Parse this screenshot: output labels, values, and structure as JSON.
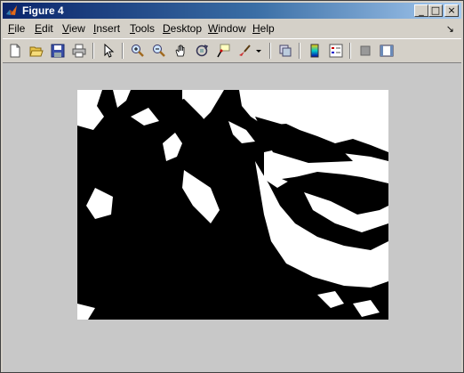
{
  "window": {
    "title": "Figure 4"
  },
  "title_buttons": {
    "minimize": "_",
    "maximize": "□",
    "close": "×"
  },
  "menu": [
    {
      "label": "File",
      "u": "F",
      "rest": "ile"
    },
    {
      "label": "Edit",
      "u": "E",
      "rest": "dit"
    },
    {
      "label": "View",
      "u": "V",
      "rest": "iew"
    },
    {
      "label": "Insert",
      "u": "I",
      "rest": "nsert"
    },
    {
      "label": "Tools",
      "u": "T",
      "rest": "ools"
    },
    {
      "label": "Desktop",
      "u": "D",
      "rest": "esktop"
    },
    {
      "label": "Window",
      "u": "W",
      "rest": "indow"
    },
    {
      "label": "Help",
      "u": "H",
      "rest": "elp"
    }
  ],
  "dock_arrow": "↘",
  "toolbar_icons": [
    "new-figure-icon",
    "open-file-icon",
    "save-icon",
    "print-icon",
    "pointer-icon",
    "zoom-in-icon",
    "zoom-out-icon",
    "pan-icon",
    "rotate-3d-icon",
    "data-cursor-icon",
    "brush-icon",
    "dropdown-icon",
    "link-plot-icon",
    "colorbar-icon",
    "legend-icon",
    "hide-plot-tools-icon",
    "show-plot-tools-icon"
  ],
  "colors": {
    "title_start": "#0a246a",
    "title_end": "#a6caf0",
    "figure_bg": "#c8c8c8",
    "image_fg": "#000000",
    "image_bg": "#ffffff"
  }
}
